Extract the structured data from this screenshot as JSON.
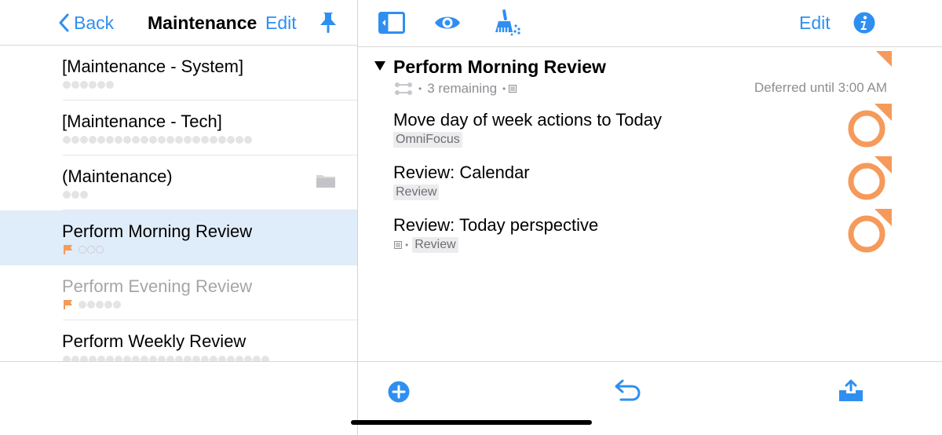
{
  "colors": {
    "accent": "#2f8ff0",
    "flag": "#f59a5a",
    "selected": "#dfecf9",
    "divider": "#d8d8da"
  },
  "sidebar": {
    "back_label": "Back",
    "title": "Maintenance",
    "edit_label": "Edit",
    "pin_icon": "pin-icon",
    "items": [
      {
        "label": "[Maintenance - System]",
        "dots": 6,
        "flagged": false,
        "dim": false,
        "selected": false
      },
      {
        "label": "[Maintenance - Tech]",
        "dots": 22,
        "flagged": false,
        "dim": false,
        "selected": false
      },
      {
        "label": "(Maintenance)",
        "dots": 3,
        "flagged": false,
        "dim": false,
        "selected": false,
        "folder": true
      },
      {
        "label": "Perform Morning Review",
        "dots": 3,
        "flagged": true,
        "dim": false,
        "selected": true,
        "ring": true
      },
      {
        "label": "Perform Evening Review",
        "dots": 5,
        "flagged": true,
        "dim": true,
        "selected": false
      },
      {
        "label": "Perform Weekly Review",
        "dots": 24,
        "flagged": false,
        "dim": false,
        "selected": false
      }
    ]
  },
  "toolbar": {
    "edit_label": "Edit",
    "icons": [
      "sidebar-toggle-icon",
      "eye-icon",
      "clean-up-icon",
      "info-icon"
    ]
  },
  "project": {
    "title": "Perform Morning Review",
    "remaining": "3 remaining",
    "deferred": "Deferred until 3:00 AM",
    "tasks": [
      {
        "title": "Move day of week actions to Today",
        "tag": "OmniFocus",
        "has_note": false
      },
      {
        "title": "Review: Calendar",
        "tag": "Review",
        "has_note": false
      },
      {
        "title": "Review: Today perspective",
        "tag": "Review",
        "has_note": true
      }
    ]
  },
  "bottom_bar": {
    "icons": [
      "add-icon",
      "undo-icon",
      "inbox-icon"
    ]
  }
}
